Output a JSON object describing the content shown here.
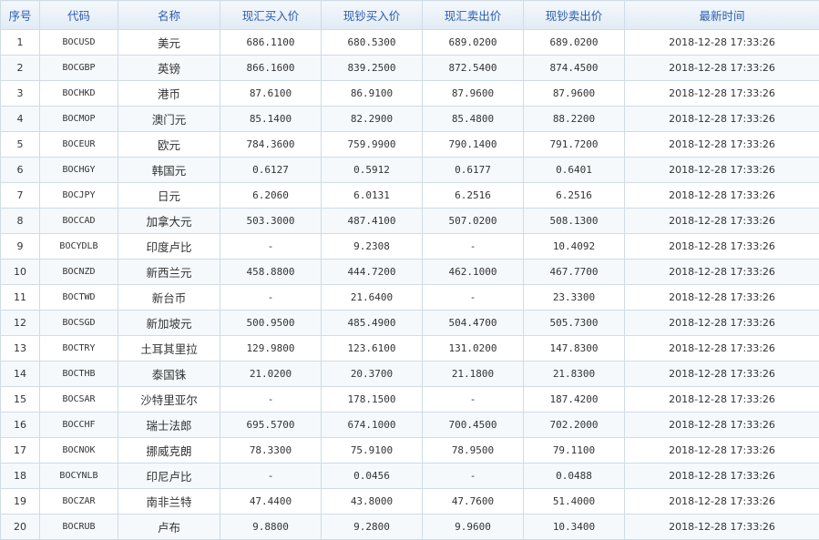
{
  "headers": [
    "序号",
    "代码",
    "名称",
    "现汇买入价",
    "现钞买入价",
    "现汇卖出价",
    "现钞卖出价",
    "最新时间"
  ],
  "rows": [
    [
      "1",
      "BOCUSD",
      "美元",
      "686.1100",
      "680.5300",
      "689.0200",
      "689.0200",
      "2018-12-28 17:33:26"
    ],
    [
      "2",
      "BOCGBP",
      "英镑",
      "866.1600",
      "839.2500",
      "872.5400",
      "874.4500",
      "2018-12-28 17:33:26"
    ],
    [
      "3",
      "BOCHKD",
      "港币",
      "87.6100",
      "86.9100",
      "87.9600",
      "87.9600",
      "2018-12-28 17:33:26"
    ],
    [
      "4",
      "BOCMOP",
      "澳门元",
      "85.1400",
      "82.2900",
      "85.4800",
      "88.2200",
      "2018-12-28 17:33:26"
    ],
    [
      "5",
      "BOCEUR",
      "欧元",
      "784.3600",
      "759.9900",
      "790.1400",
      "791.7200",
      "2018-12-28 17:33:26"
    ],
    [
      "6",
      "BOCHGY",
      "韩国元",
      "0.6127",
      "0.5912",
      "0.6177",
      "0.6401",
      "2018-12-28 17:33:26"
    ],
    [
      "7",
      "BOCJPY",
      "日元",
      "6.2060",
      "6.0131",
      "6.2516",
      "6.2516",
      "2018-12-28 17:33:26"
    ],
    [
      "8",
      "BOCCAD",
      "加拿大元",
      "503.3000",
      "487.4100",
      "507.0200",
      "508.1300",
      "2018-12-28 17:33:26"
    ],
    [
      "9",
      "BOCYDLB",
      "印度卢比",
      "-",
      "9.2308",
      "-",
      "10.4092",
      "2018-12-28 17:33:26"
    ],
    [
      "10",
      "BOCNZD",
      "新西兰元",
      "458.8800",
      "444.7200",
      "462.1000",
      "467.7700",
      "2018-12-28 17:33:26"
    ],
    [
      "11",
      "BOCTWD",
      "新台币",
      "-",
      "21.6400",
      "-",
      "23.3300",
      "2018-12-28 17:33:26"
    ],
    [
      "12",
      "BOCSGD",
      "新加坡元",
      "500.9500",
      "485.4900",
      "504.4700",
      "505.7300",
      "2018-12-28 17:33:26"
    ],
    [
      "13",
      "BOCTRY",
      "土耳其里拉",
      "129.9800",
      "123.6100",
      "131.0200",
      "147.8300",
      "2018-12-28 17:33:26"
    ],
    [
      "14",
      "BOCTHB",
      "泰国铢",
      "21.0200",
      "20.3700",
      "21.1800",
      "21.8300",
      "2018-12-28 17:33:26"
    ],
    [
      "15",
      "BOCSAR",
      "沙特里亚尔",
      "-",
      "178.1500",
      "-",
      "187.4200",
      "2018-12-28 17:33:26"
    ],
    [
      "16",
      "BOCCHF",
      "瑞士法郎",
      "695.5700",
      "674.1000",
      "700.4500",
      "702.2000",
      "2018-12-28 17:33:26"
    ],
    [
      "17",
      "BOCNOK",
      "挪威克朗",
      "78.3300",
      "75.9100",
      "78.9500",
      "79.1100",
      "2018-12-28 17:33:26"
    ],
    [
      "18",
      "BOCYNLB",
      "印尼卢比",
      "-",
      "0.0456",
      "-",
      "0.0488",
      "2018-12-28 17:33:26"
    ],
    [
      "19",
      "BOCZAR",
      "南非兰特",
      "47.4400",
      "43.8000",
      "47.7600",
      "51.4000",
      "2018-12-28 17:33:26"
    ],
    [
      "20",
      "BOCRUB",
      "卢布",
      "9.8800",
      "9.2800",
      "9.9600",
      "10.3400",
      "2018-12-28 17:33:26"
    ]
  ]
}
